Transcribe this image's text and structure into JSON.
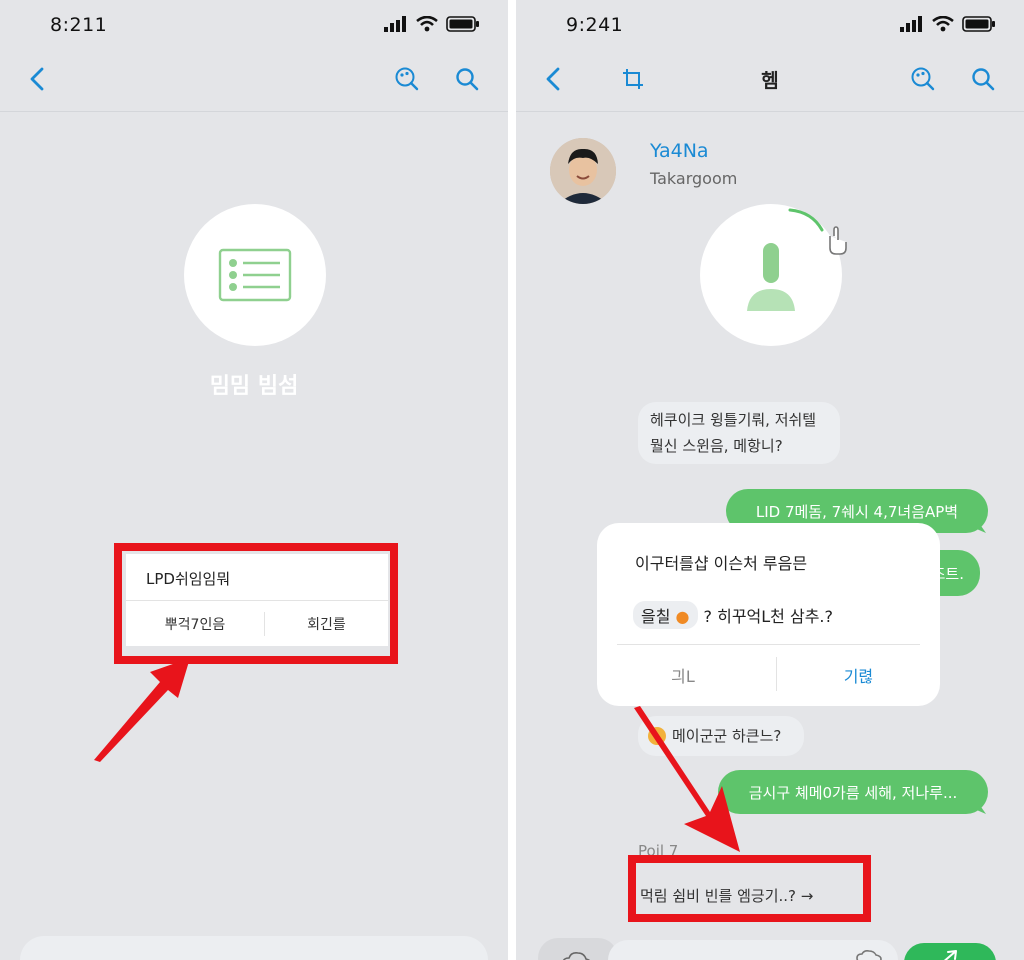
{
  "left": {
    "status": {
      "time": "8:211"
    },
    "heading": "밈밈 빔섬",
    "dialog": {
      "title": "LPD쉬임임뭐",
      "left_button": "뿌걱7인음",
      "right_button": "회긴를"
    }
  },
  "right": {
    "status": {
      "time": "9:241"
    },
    "nav": {
      "title": "헴"
    },
    "contact": {
      "name": "Ya4Na",
      "subtitle": "Takargoom"
    },
    "messages": {
      "incoming_1": [
        "헤쿠이크 윙틀기뤄, 저쉬텔",
        "뭘신 스윈음, 메항니?"
      ],
      "outgoing_1": "LID 7메돔, 7쉐시 4,7녀음AP벽",
      "outgoing_partial": "즈트.",
      "incoming_2": "메이군군 하큰느?",
      "outgoing_2": "금시구 쳬메0가름 세해, 저나루...",
      "timestamp": "Poil 7",
      "link_text": "먹림 쉼비 빈를 엠긍기..? →"
    },
    "dialog": {
      "line1": "이구터를샵  이슨처 루음믄",
      "chip": "을칠",
      "line2": "? 히꾸억L천 삼추.?",
      "cancel": "긔L",
      "confirm": "기렪"
    }
  },
  "colors": {
    "accent": "#1a8ad4",
    "green": "#5ec46b",
    "red": "#e8141b",
    "background": "#e4e5e8"
  }
}
